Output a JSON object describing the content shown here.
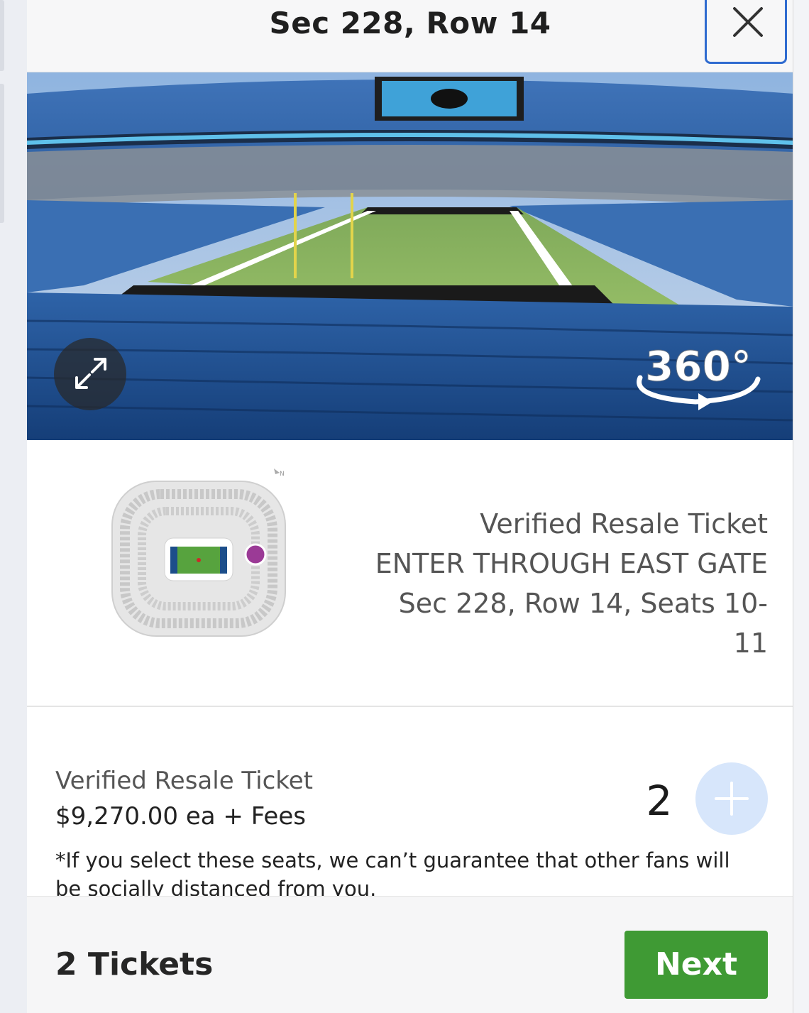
{
  "header": {
    "title": "Sec 228, Row 14",
    "close_icon": "close-icon"
  },
  "view": {
    "badge_360": "360°",
    "expand_icon": "expand-icon"
  },
  "info": {
    "line1": "Verified Resale Ticket",
    "line2": "ENTER THROUGH EAST GATE",
    "line3": "Sec 228, Row 14, Seats 10-11",
    "marker_color": "#9b3a96"
  },
  "ticket": {
    "type": "Verified Resale Ticket",
    "price": "$9,270.00 ea + Fees",
    "quantity": "2",
    "note": "*If you select these seats, we can’t guarantee that other fans will be socially distanced from you."
  },
  "footer": {
    "tickets_label": "2 Tickets",
    "next_label": "Next",
    "next_color": "#3f9a34"
  }
}
